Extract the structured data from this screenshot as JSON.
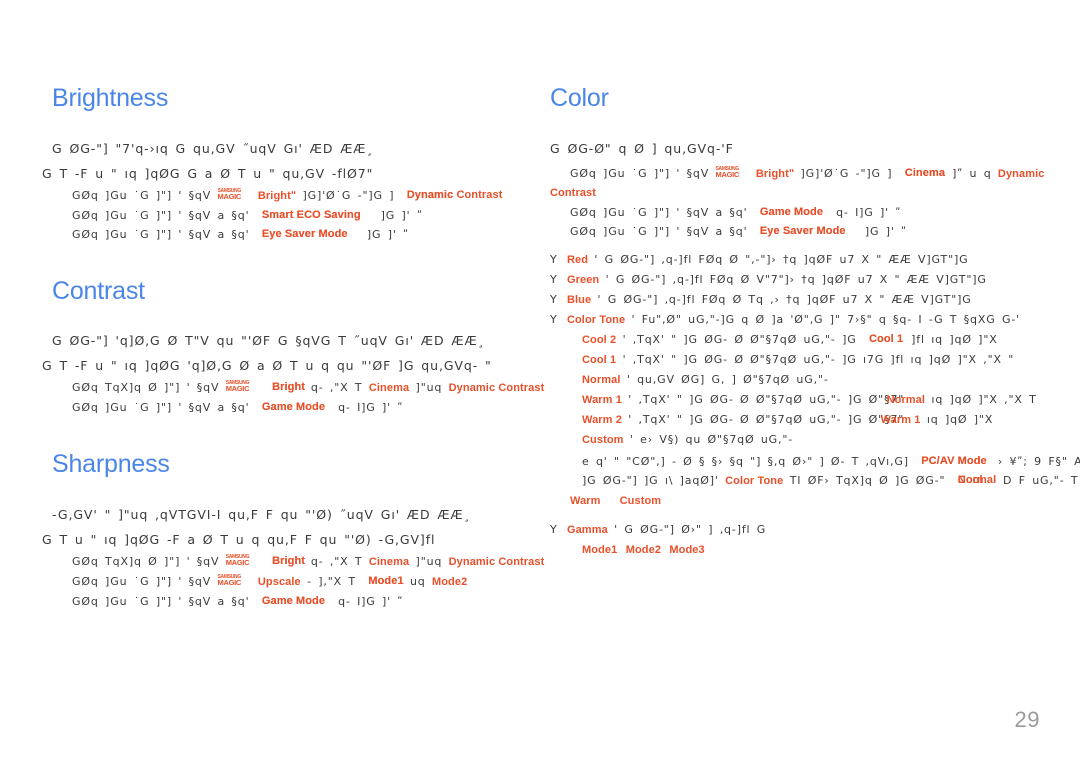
{
  "document": {
    "page_number": "29",
    "accent_heading_color": "#4a86e8",
    "term_color": "#e8502a",
    "body_color": "#3a3a3a"
  },
  "left_column": {
    "sections": [
      {
        "id": "brightness",
        "title": "Brightness",
        "paragraph_lines": [
          "G ØG-\"]   \"7'q-›ıq  G    qu,GV    ˝uqV Gı' ÆD ÆÆ¸",
          "G T -F     u  \" ıq ]qØG  G   a Ø T u  \" qu,GV   -flØ7\""
        ],
        "rows": [
          {
            "pre": "GØq ]Gu  ˙G ]\"]   '      §qV",
            "logo": {
              "line1": "SAMSUNG",
              "line2": "MAGIC"
            },
            "term1": "Brightʺ",
            "mid": "]G]'Ø˙G -\"]G  ]",
            "term2": "Dynamic Contrast",
            "term2_overlap": "Dynamic",
            "post": ""
          },
          {
            "pre": "GØq ]Gu  ˙G ]\"]   '      §qV     a §q'",
            "term1": "Smart ECO Saving",
            "term1_overlap": "Smart ECO Saving",
            "mid": "]G     ]' ʺ",
            "post": ""
          },
          {
            "pre": "GØq ]Gu  ˙G ]\"]   '      §qV     a §q'",
            "term1": "Eye Saver Mode",
            "term1_overlap": "Eye Saver Mode",
            "mid": "]G     ]' ʺ",
            "post": ""
          }
        ]
      },
      {
        "id": "contrast",
        "title": "Contrast",
        "paragraph_lines": [
          "G ØG-\"]  'q]Ø,G Ø  T\"V  qu \"'ØF G §qVG  T ˝uqV Gı' ÆD ÆÆ¸",
          "G T -F     u  \" ıq ]qØG 'q]Ø,G Ø a Ø T u  q  qu \"'ØF ]G qu,GVq- \""
        ],
        "rows": [
          {
            "pre": "GØq TqX]q Ø ]\"]   '      §qV",
            "logo": {
              "line1": "SAMSUNG",
              "line2": "MAGIC"
            },
            "term1": "Bright",
            "term1_overlap": "Bright",
            "mid": "q- ,\"X  T",
            "term2": "Cinema",
            "mid2": "]\"uq",
            "term3": "Dynamic Contrast",
            "post": ""
          },
          {
            "pre": "GØq ]Gu  ˙G ]\"]   '      §qV     a §q'",
            "term1": "Game Mode",
            "term1_overlap": "Game Mode",
            "mid": "q- I]G     ]' ʺ",
            "post": ""
          }
        ]
      },
      {
        "id": "sharpness",
        "title": "Sharpness",
        "paragraph_lines": [
          "-G,GV'   \" ]\"uq ,qVTGVI-I qu,F F qu \"'Ø) ˝uqV Gı' ÆD ÆÆ¸",
          "G T u  \" ıq ]qØG -F    a Ø T u  q  qu,F F qu \"'Ø) -G,GV]fl"
        ],
        "rows": [
          {
            "pre": "GØq TqX]q Ø ]\"]   '      §qV",
            "logo": {
              "line1": "SAMSUNG",
              "line2": "MAGIC"
            },
            "term1": "Bright",
            "term1_overlap": "Bright",
            "mid": "q- ,\"X  T",
            "term2": "Cinema",
            "mid2": "]\"uq",
            "term3": "Dynamic Contrast",
            "post": ""
          },
          {
            "pre": "GØq ]Gu  ˙G ]\"]   '      §qV",
            "logo": {
              "line1": "SAMSUNG",
              "line2": "MAGIC"
            },
            "term1": "Upscale",
            "mid": "- ],\"X  T",
            "term2": "Mode1",
            "term2_overlap": "Mode1",
            "mid2": "uq",
            "term3": "Mode2",
            "post": ""
          },
          {
            "pre": "GØq ]Gu  ˙G ]\"]   '      §qV     a §q'",
            "term1": "Game Mode",
            "term1_overlap": "Game Mode",
            "mid": "q- I]G     ]' ʺ",
            "post": ""
          }
        ]
      }
    ]
  },
  "right_column": {
    "sections": [
      {
        "id": "color",
        "title": "Color",
        "paragraph_lines": [
          "G ØG-Ø\" q  Ø ] qu,GVq-'F"
        ],
        "rows": [
          {
            "pre": "GØq ]Gu  ˙G ]\"]   '      §qV",
            "logo": {
              "line1": "SAMSUNG",
              "line2": "MAGIC"
            },
            "term1": "Brightʺ",
            "mid": "]G]'Ø˙G -\"]G  ]",
            "term2": "Cinema",
            "term2_overlap": "Cinema",
            "mid2": "]ʺ u q",
            "term3": "Dynamic",
            "wrap": "Contrast"
          },
          {
            "pre": "GØq ]Gu  ˙G ]\"]   '      §qV     a §q'",
            "term1": "Game Mode",
            "term1_overlap": "Game Mode",
            "mid": "q- I]G     ]' ʺ"
          },
          {
            "pre": "GØq ]Gu  ˙G ]\"]   '      §qV     a §q'",
            "term1": "Eye Saver Mode",
            "term1_overlap": "Eye Saver Mode",
            "mid": "]G     ]' ʺ"
          }
        ],
        "bullets": [
          {
            "bullet": "Y",
            "term": "Red",
            "text": "'  G ØG-\"]    ,q-]fl  FØq Ø    \",-\"]›  †q ]qØF u7 X        \"  ÆÆ V]GT\"]G"
          },
          {
            "bullet": "Y",
            "term": "Green",
            "text": "'   G ØG-\"]    ,q-]fl   FØq Ø  V\"7\"]›   †q ]qØF u7 X        \"  ÆÆ V]GT\"]G"
          },
          {
            "bullet": "Y",
            "term": "Blue",
            "text": "'  G ØG-\"]    ,q-]fl  FØq Ø  Tq ,›  †q ]qØF u7 X      \"  ÆÆ V]GT\"]G"
          },
          {
            "bullet": "Y",
            "term": "Color Tone",
            "text": "'   Fu\",Ø\" uG,\"-]G q   Ø ]a 'Ø\",G ]\" 7›§\" q §q-  I -G  T §qXG G-'"
          }
        ],
        "tone_options": [
          {
            "term": "Cool 2",
            "text": "' ,TqX'   \" ]G ØG- Ø Ø\"§7qØ   uG,\"- ]G",
            "term_inline": "Cool 1",
            "term_inline_overlap": "Cool 1",
            "text2": "]fl       ıq ]qØ   ]\"X"
          },
          {
            "term": "Cool 1",
            "text": "' ,TqX'   \" ]G ØG- Ø Ø\"§7qØ   uG,\"- ]G  ı7G ]fl       ıq ]qØ   ]\"X ,\"X \""
          },
          {
            "term": "Normal",
            "text": "'   qu,GV    ØG] G, ]   Ø\"§7qØ   uG,\"-"
          },
          {
            "term": "Warm 1",
            "text": "' ,TqX'   \" ]G ØG- Ø Ø\"§7qØ   uG,\"- ]G Ø\"§7\"",
            "term_inline": "Normal",
            "text2": "ıq ]qØ   ]\"X ,\"X T"
          },
          {
            "term": "Warm 2",
            "text": "' ,TqX'   \" ]G ØG- Ø Ø\"§7qØ   uG,\"- ]G Ø\"§7\"",
            "term_inline": "Warm 1",
            "text2": "ıq ]qØ   ]\"X"
          },
          {
            "term": "Custom",
            "text": "' e› V§) qu   Ø\"§7qØ   uG,\"-"
          }
        ],
        "note_lines": [
          {
            "pre": "e q'     \" \"CØ\",]  - Ø § §› §q \"] §,q Ø›\" ]   Ø- T ,qVı,G]",
            "term": "PC/AV Mode",
            "term_overlap": "PC/AV Mode",
            "post": "› ¥ʺ; 9   F§\" A"
          },
          {
            "pre": "]G ØG-\"] ]G ı\\ ]aqØ]'",
            "term": "Color Tone",
            "mid": "TI   ØF›   TqX]q Ø   ]G ØG-\"",
            "term2": "Cool",
            "term2_overlap": "Normal",
            "post": "D F uG,\"- T"
          },
          {
            "terms": [
              "Warm",
              "Custom"
            ]
          }
        ],
        "gamma": {
          "bullet": "Y",
          "term": "Gamma",
          "text": "'   G ØG-\"]     Ø›\" ]    ,q-]fl   G",
          "modes": [
            "Mode1",
            "Mode2",
            "Mode3"
          ]
        }
      }
    ]
  }
}
